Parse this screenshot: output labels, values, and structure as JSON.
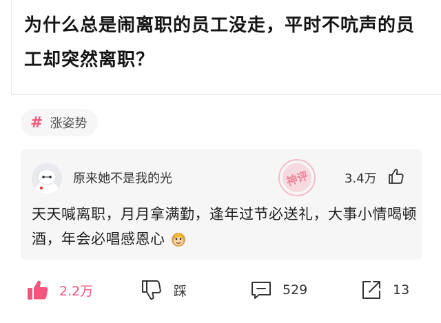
{
  "question": {
    "title": "为什么总是闹离职的员工没走，平时不吭声的员工却突然离职？"
  },
  "topic_tag": {
    "icon": "hash-icon",
    "symbol": "#",
    "label": "涨姿势"
  },
  "top_comment": {
    "user_name": "原来她不是我的光",
    "like_count": "3.4万",
    "body": "天天喊离职，月月拿满勤，逢年过节必送礼，大事小情喝顿酒，年会必唱感恩心",
    "badge_text": "神评"
  },
  "actions": {
    "like": {
      "label": "2.2万",
      "icon": "thumbs-up-icon",
      "color": "#f2557b"
    },
    "dislike": {
      "label": "踩",
      "icon": "thumbs-down-icon"
    },
    "comment": {
      "label": "529",
      "icon": "comment-icon"
    },
    "share": {
      "label": "13",
      "icon": "share-icon"
    }
  },
  "colors": {
    "accent": "#f2557b",
    "card_bg": "#f6f6f6",
    "badge": "#f4a7b4"
  }
}
